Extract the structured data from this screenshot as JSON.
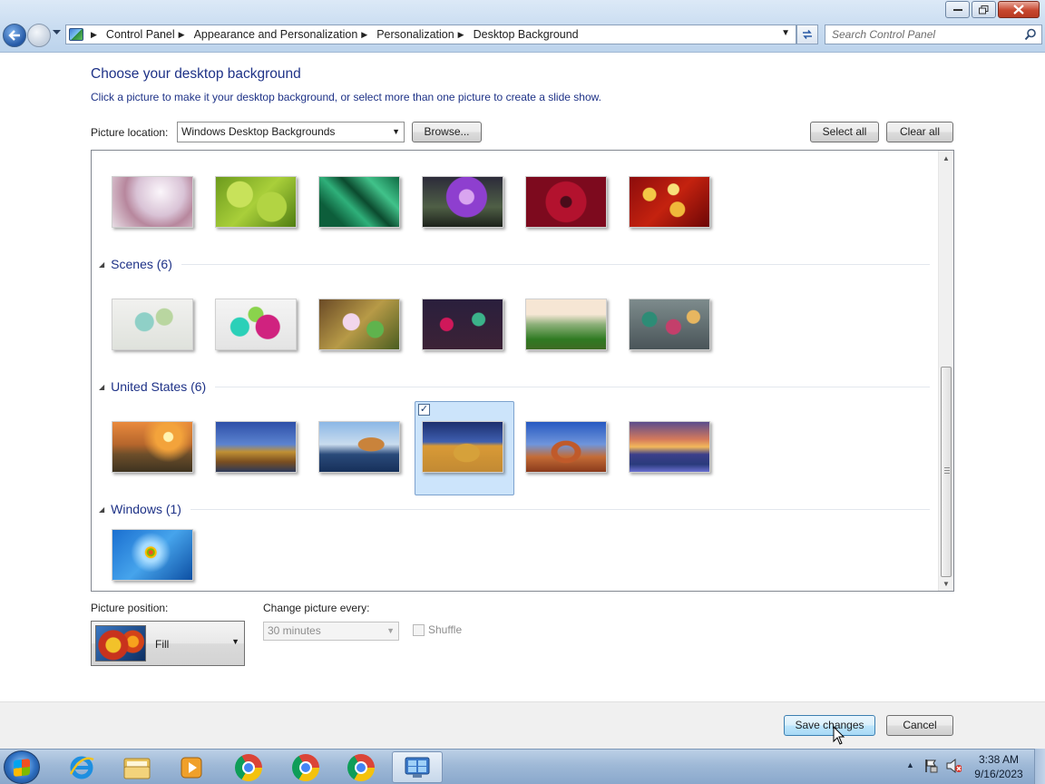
{
  "address_bar": {
    "breadcrumbs": [
      "Control Panel",
      "Appearance and Personalization",
      "Personalization",
      "Desktop Background"
    ]
  },
  "search": {
    "placeholder": "Search Control Panel"
  },
  "page": {
    "title": "Choose your desktop background",
    "subtitle": "Click a picture to make it your desktop background, or select more than one picture to create a slide show."
  },
  "picture_location": {
    "label": "Picture location:",
    "value": "Windows Desktop Backgrounds",
    "browse_label": "Browse...",
    "select_all_label": "Select all",
    "clear_all_label": "Clear all"
  },
  "groups": [
    {
      "name": "Scenes (6)"
    },
    {
      "name": "United States (6)"
    },
    {
      "name": "Windows (1)"
    }
  ],
  "selected_picture": "hay-bale",
  "picture_position": {
    "label": "Picture position:",
    "value": "Fill"
  },
  "change_picture": {
    "label": "Change picture every:",
    "value": "30 minutes",
    "shuffle_label": "Shuffle",
    "shuffle_checked": false
  },
  "buttons": {
    "save": "Save changes",
    "cancel": "Cancel"
  },
  "clock": {
    "time": "3:38 AM",
    "date": "9/16/2023"
  }
}
